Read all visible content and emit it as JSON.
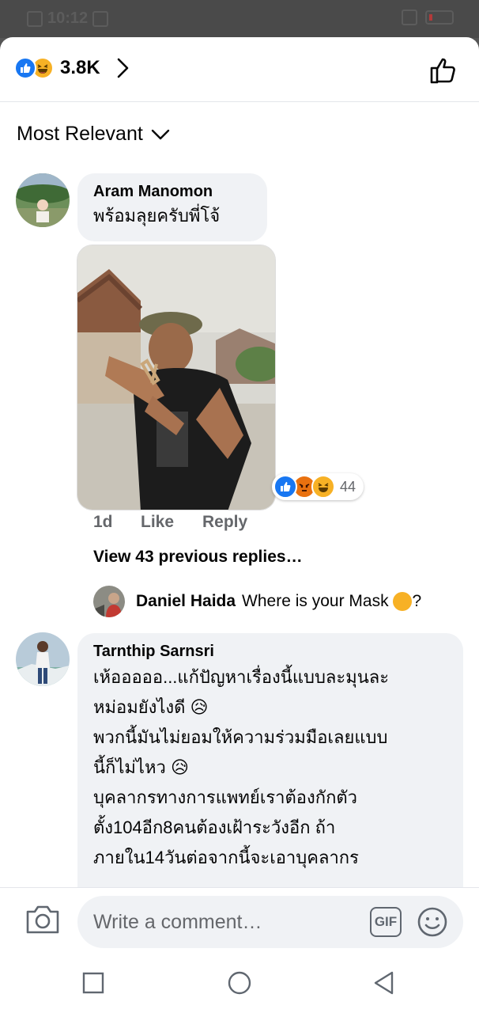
{
  "status_bar": {
    "time": "10:12"
  },
  "header": {
    "reaction_count": "3.8K",
    "reactions": [
      "like-icon",
      "haha-icon"
    ]
  },
  "sort": {
    "label": "Most Relevant"
  },
  "comments": [
    {
      "author": "Aram Manomon",
      "text": "พร้อมลุยครับพี่โจ้",
      "reaction_count": "44",
      "reactions": [
        "like-icon",
        "angry-icon",
        "haha-icon"
      ],
      "time": "1d",
      "like_label": "Like",
      "reply_label": "Reply"
    },
    {
      "author": "Tarnthip Sarnsri",
      "lines": [
        "เห้อออออ...แก้ปัญหาเรื่องนี้แบบละมุนละ",
        "หม่อมยังไงดี 😥",
        "พวกนี้มันไม่ยอมให้ความร่วมมือเลยแบบ",
        "นี้ก็ไม่ไหว 😥",
        "บุคลากรทางการแพทย์เราต้องกักตัว",
        "ตั้ง104อีก8คนต้องเฝ้าระวังอีก ถ้า",
        "ภายใน14วันต่อจากนี้จะเอาบุคลากร"
      ]
    }
  ],
  "view_previous": "View 43 previous replies…",
  "reply": {
    "author": "Daniel Haida",
    "text": "Where is your Mask",
    "suffix": "?"
  },
  "composer": {
    "placeholder": "Write a comment…",
    "gif_label": "GIF"
  },
  "colors": {
    "like_blue": "#1877f2",
    "haha_yellow": "#f7b125",
    "angry_orange": "#e9710f",
    "bubble_gray": "#f0f2f5",
    "meta_gray": "#65676b"
  }
}
